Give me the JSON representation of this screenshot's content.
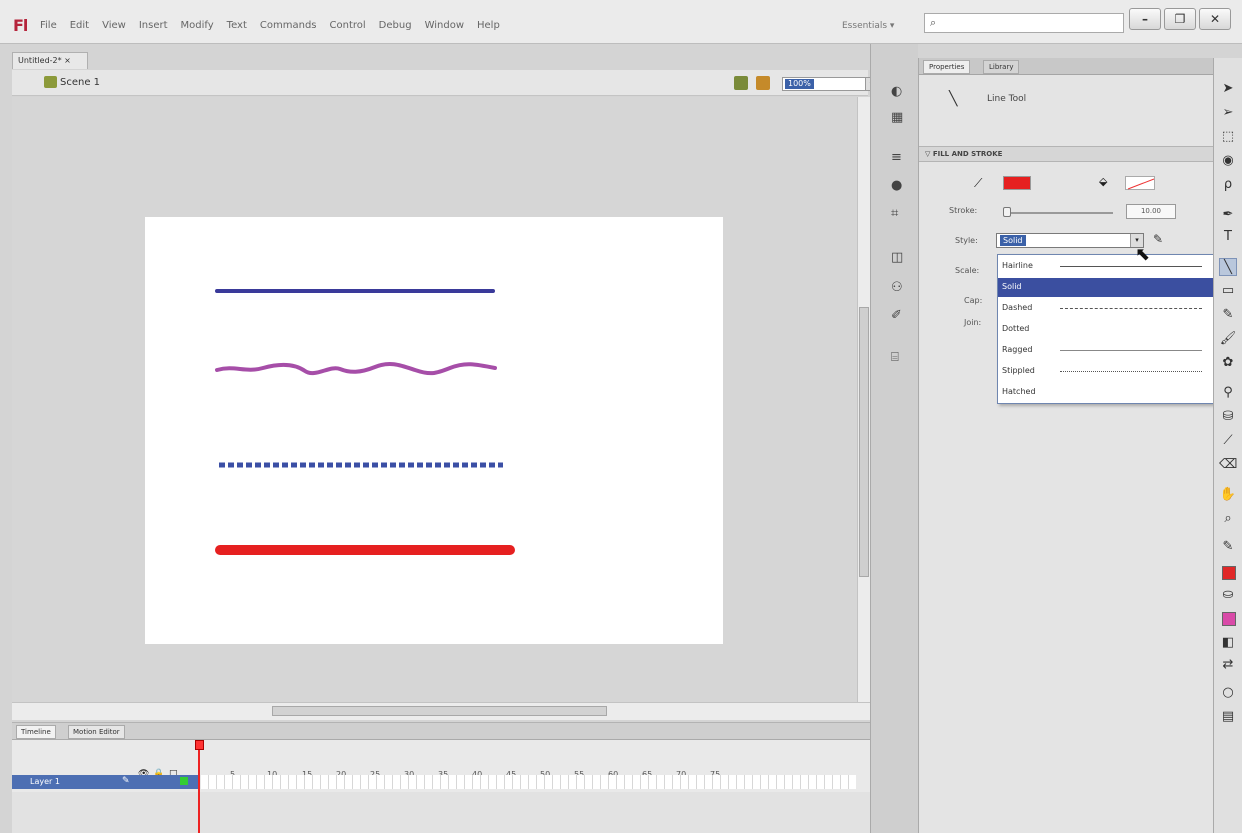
{
  "app": {
    "logo": "Fl",
    "menus": [
      "File",
      "Edit",
      "View",
      "Insert",
      "Modify",
      "Text",
      "Commands",
      "Control",
      "Debug",
      "Window",
      "Help"
    ],
    "workspace_label": "Essentials",
    "search_icon": "search-icon",
    "window_buttons": [
      "–",
      "❐",
      "✕"
    ]
  },
  "document": {
    "tab_label": "Untitled-2* ×",
    "scene_label": "Scene 1",
    "zoom_value": "100%",
    "zoom_arrow": "▾"
  },
  "stage": {
    "background": "#ffffff",
    "lines": [
      {
        "name": "hairline",
        "color": "#3a3a9a"
      },
      {
        "name": "ragged",
        "color": "#a64ea8"
      },
      {
        "name": "dotted",
        "color": "#3b4fa5"
      },
      {
        "name": "solid",
        "color": "#e62020"
      }
    ]
  },
  "timeline": {
    "tabs": [
      "Timeline",
      "Motion Editor"
    ],
    "frame_numbers": [
      "5",
      "10",
      "15",
      "20",
      "25",
      "30",
      "35",
      "40",
      "45",
      "50",
      "55",
      "60",
      "65",
      "70",
      "75"
    ],
    "layer_name": "Layer 1"
  },
  "properties": {
    "tabs": [
      "Properties",
      "Library"
    ],
    "tool_name": "Line Tool",
    "section_title": "FILL AND STROKE",
    "stroke_label": "Stroke:",
    "stroke_value": "10.00",
    "style_label": "Style:",
    "style_value": "Solid",
    "scale_label": "Scale:",
    "cap_label": "Cap:",
    "join_label": "Join:"
  },
  "style_dropdown": {
    "options": [
      {
        "label": "Hairline",
        "sample": "hairline"
      },
      {
        "label": "Solid",
        "sample": "none",
        "selected": true
      },
      {
        "label": "Dashed",
        "sample": "dashed"
      },
      {
        "label": "Dotted",
        "sample": "none"
      },
      {
        "label": "Ragged",
        "sample": "ragged"
      },
      {
        "label": "Stippled",
        "sample": "stippled"
      },
      {
        "label": "Hatched",
        "sample": "none"
      }
    ]
  },
  "colors": {
    "stroke": "#e62020",
    "fill_swatch_tool": "#e02828",
    "fill_swatch_pink": "#d94aa8",
    "selection": "#3b4fa0"
  }
}
